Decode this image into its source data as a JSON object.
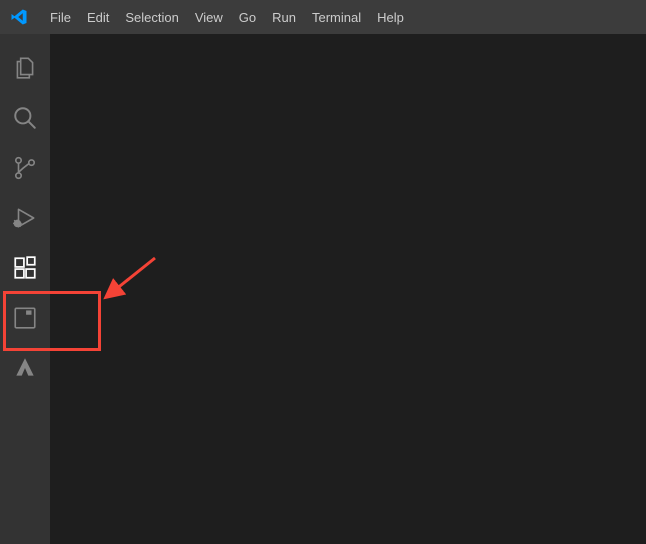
{
  "menu": {
    "file": "File",
    "edit": "Edit",
    "selection": "Selection",
    "view": "View",
    "go": "Go",
    "run": "Run",
    "terminal": "Terminal",
    "help": "Help"
  },
  "activity_bar": {
    "explorer": "Explorer",
    "search": "Search",
    "source_control": "Source Control",
    "run_debug": "Run and Debug",
    "extensions": "Extensions",
    "remote": "Remote Explorer",
    "azure": "Azure"
  },
  "colors": {
    "annotation": "#f44336",
    "logo": "#0098ff"
  }
}
